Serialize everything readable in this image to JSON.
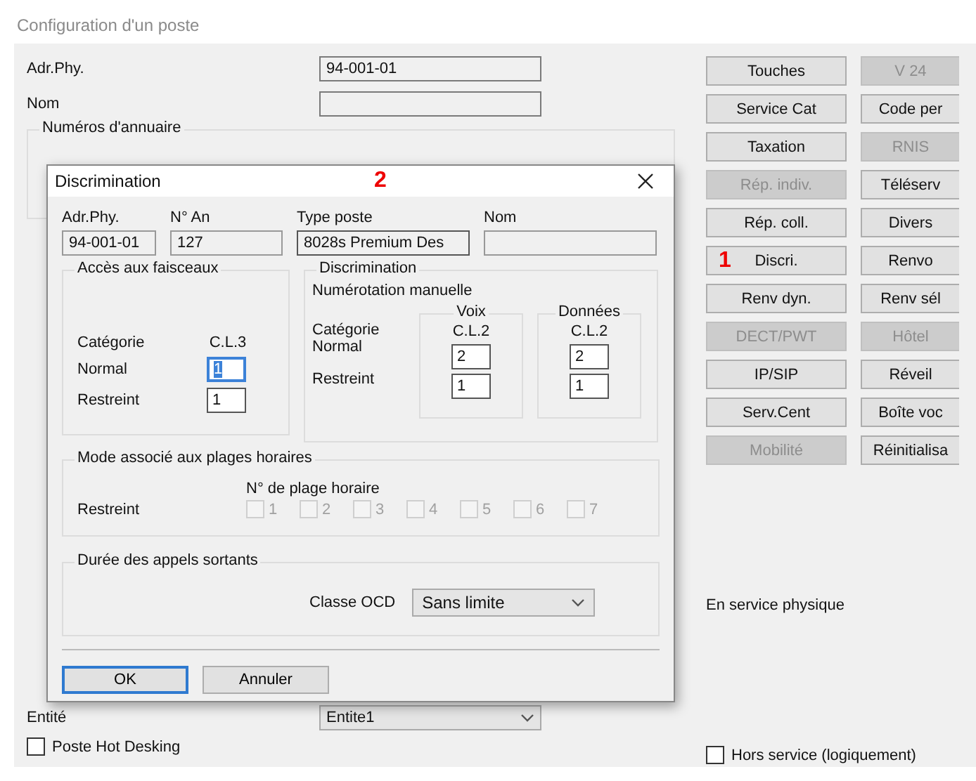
{
  "window": {
    "title": "Configuration d'un poste"
  },
  "station_fields": [
    {
      "label": "Adr.Phy.",
      "value": "94-001-01"
    },
    {
      "label": "Nom"
    }
  ],
  "directory_group": {
    "legend": "Numéros d'annuaire"
  },
  "entity": {
    "label": "Entité",
    "value": "Entite1"
  },
  "hot_desking": {
    "label": "Poste Hot Desking",
    "checked": false
  },
  "button_columns": [
    {
      "buttons": [
        {
          "label": "Touches",
          "disabled": false
        },
        {
          "label": "Service Cat",
          "disabled": false
        },
        {
          "label": "Taxation",
          "disabled": false
        },
        {
          "label": "Rép. indiv.",
          "disabled": true
        },
        {
          "label": "Rép. coll.",
          "disabled": false
        },
        {
          "label": "Discri.",
          "disabled": false,
          "marker": "1"
        },
        {
          "label": "Renv dyn.",
          "disabled": false
        },
        {
          "label": "DECT/PWT",
          "disabled": true
        },
        {
          "label": "IP/SIP",
          "disabled": false
        },
        {
          "label": "Serv.Cent",
          "disabled": false
        },
        {
          "label": "Mobilité",
          "disabled": true
        }
      ]
    },
    {
      "buttons": [
        {
          "label": "V 24",
          "disabled": true
        },
        {
          "label": "Code per",
          "disabled": false
        },
        {
          "label": "RNIS",
          "disabled": true
        },
        {
          "label": "Téléserv",
          "disabled": false
        },
        {
          "label": "Divers",
          "disabled": false
        },
        {
          "label": "Renvo",
          "disabled": false
        },
        {
          "label": "Renv sél",
          "disabled": false
        },
        {
          "label": "Hôtel",
          "disabled": true
        },
        {
          "label": "Réveil",
          "disabled": false
        },
        {
          "label": "Boîte voc",
          "disabled": false
        },
        {
          "label": "Réinitialisa",
          "disabled": false
        }
      ]
    }
  ],
  "status_text": "En service physique",
  "out_of_service": {
    "label": "Hors service (logiquement)",
    "checked": false
  },
  "dialog": {
    "title": "Discrimination",
    "marker": "2",
    "headers": [
      {
        "label": "Adr.Phy.",
        "value": "94-001-01"
      },
      {
        "label": "N° An",
        "value": "127"
      },
      {
        "label": "Type poste",
        "value": "8028s Premium Des"
      },
      {
        "label": "Nom"
      }
    ],
    "trunk_access": {
      "legend": "Accès aux faisceaux",
      "category_label": "Catégorie",
      "category": "C.L.3",
      "rows": [
        {
          "label": "Normal",
          "value": "1",
          "focused": true
        },
        {
          "label": "Restreint",
          "value": "1",
          "focused": false
        }
      ]
    },
    "discrimination": {
      "legend": "Discrimination",
      "subtitle": "Numérotation manuelle",
      "category_label": "Catégorie",
      "row_labels": [
        "Normal",
        "Restreint"
      ],
      "columns": [
        {
          "legend": "Voix",
          "category": "C.L.2",
          "values": [
            "2",
            "1"
          ]
        },
        {
          "legend": "Données",
          "category": "C.L.2",
          "values": [
            "2",
            "1"
          ]
        }
      ]
    },
    "time_ranges": {
      "legend": "Mode associé aux plages horaires",
      "heading": "N° de plage horaire",
      "row_label": "Restreint",
      "ranges": [
        {
          "label": "1",
          "checked": false,
          "disabled": true
        },
        {
          "label": "2",
          "checked": false,
          "disabled": true
        },
        {
          "label": "3",
          "checked": false,
          "disabled": true
        },
        {
          "label": "4",
          "checked": false,
          "disabled": true
        },
        {
          "label": "5",
          "checked": false,
          "disabled": true
        },
        {
          "label": "6",
          "checked": false,
          "disabled": true
        },
        {
          "label": "7",
          "checked": false,
          "disabled": true
        }
      ]
    },
    "call_duration": {
      "legend": "Durée des appels sortants",
      "label": "Classe OCD",
      "value": "Sans limite"
    },
    "buttons": [
      {
        "label": "OK",
        "default": true
      },
      {
        "label": "Annuler",
        "default": false
      }
    ]
  }
}
